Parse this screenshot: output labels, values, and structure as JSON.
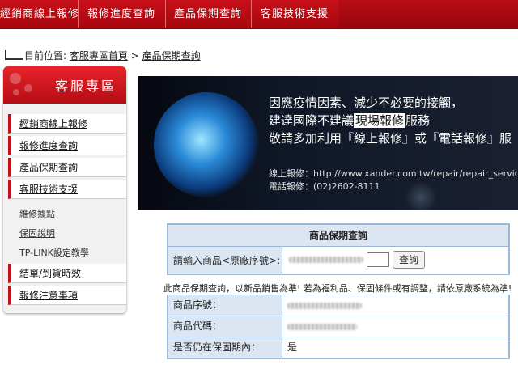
{
  "topnav": {
    "items": [
      "經銷商線上報修",
      "報修進度查詢",
      "產品保期查詢",
      "客服技術支援"
    ]
  },
  "breadcrumb": {
    "prefix": "目前位置:",
    "home": "客服專區首頁",
    "sep": ">",
    "current": "產品保期查詢"
  },
  "sidebar": {
    "title": "客服專區",
    "menu": [
      "經銷商線上報修",
      "報修進度查詢",
      "產品保期查詢",
      "客服技術支援"
    ],
    "sub": [
      "維修據點",
      "保固說明",
      "TP-LINK設定教學"
    ],
    "menu2": [
      "結單/到貨時效",
      "報修注意事項"
    ]
  },
  "banner": {
    "line1": "因應疫情因素、減少不必要的接觸，",
    "line2_a": "建達國際不建議",
    "line2_hl": "現場報修",
    "line2_b": "服務",
    "line3": "敬請多加利用『線上報修』或『電話報修』服",
    "online": "線上報修：http://www.xander.com.tw/repair/repair_service.as",
    "phone": "電話報修：(02)2602-8111"
  },
  "query": {
    "title": "商品保期查詢",
    "label": "請輸入商品<原廠序號>:",
    "button": "查詢"
  },
  "notice": "此商品保期查詢，以新品銷售為準! 若為福利品、保固條件或有調整，請依原廠系統為準!",
  "result": {
    "rows": [
      {
        "label": "商品序號：",
        "value": ""
      },
      {
        "label": "商品代碼：",
        "value": ""
      },
      {
        "label": "是否仍在保固期內：",
        "value": "是"
      }
    ]
  },
  "colors": {
    "brand": "#c8101a",
    "table_head": "#dbe6f2",
    "table_border": "#9ab6d6"
  }
}
